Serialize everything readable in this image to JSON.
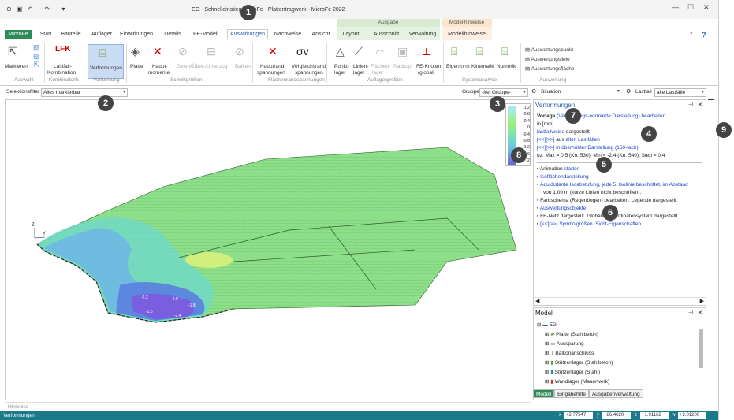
{
  "title": "EG - Schnelleinstieg MicroFe - Plattentragwerk - MicroFe 2022",
  "context_groups": {
    "ausgabe": "Ausgabe",
    "modellhinweise": "Modellhinweise"
  },
  "tabs": [
    "MicroFe",
    "Start",
    "Bauteile",
    "Auflager",
    "Einwirkungen",
    "Details",
    "FE-Modell",
    "Auswirkungen",
    "Nachweise",
    "Ansicht",
    "Layout",
    "Ausschnitt",
    "Verwaltung",
    "Modellhinweise"
  ],
  "ribbon": {
    "markieren": "Markieren",
    "lfk": "LFK",
    "lastfall": "Lastfall-",
    "kombination": "Kombination",
    "verformungen": "Verformungen",
    "platte": "Platte",
    "haupt": "Haupt-",
    "momente": "momente",
    "gelenk": "Gelenk",
    "ueber": "Über-/Unterzug",
    "balken": "Balken",
    "hauptrand": "Hauptrand-",
    "spannungen": "spannungen",
    "vergleich": "Vergleichsrand-",
    "spannungen2": "spannungen",
    "punkt": "Punkt-",
    "lager": "lager",
    "linien": "Linien-",
    "lager2": "lager",
    "flaechen": "Flächen-",
    "lager3": "lager",
    "plattkopf": "Plattkopf",
    "feknoten": "FE-Knoten",
    "global": "(global)",
    "eigenform": "Eigenform",
    "kinematik": "Kinematik",
    "numerik": "Numerik",
    "auswertungspunkt": "Auswertungspunkt",
    "auswertungslinie": "Auswertungslinie",
    "auswertungsflaeche": "Auswertungsfläche",
    "sigma": "σv",
    "groups": [
      "Auswahl",
      "Kombinatorik",
      "Verformung",
      "Schnittgrößen",
      "Flächenrandspannungen",
      "Auflagergrößen",
      "Systemanalyse",
      "Auswertung"
    ]
  },
  "filter": {
    "label": "Selektionsfilter",
    "value": "Alles markierbar",
    "gruppe_label": "Gruppe",
    "gruppe": "-frei Gruppe-",
    "situation": "Situation",
    "lastfall_label": "Lastfall",
    "lastfall": "alle Lastfälle"
  },
  "legend": [
    "1.2",
    "0.8",
    "0.4",
    "0",
    "-0.4",
    "-0.8",
    "-1.2",
    "-1.6",
    "-2"
  ],
  "panel": {
    "title": "Verformungen",
    "vorlage": "Vorlage",
    "vorlage_link": "(Verformungs-normierte Darstellung)",
    "bearbeiten": "bearbeiten",
    "unit": "in [mm]",
    "lastfallweise": "lastfallweise",
    "dargestellt": "dargestellt",
    "l1a": "[<<][>>]",
    "l1b": "aus",
    "l1c": "allen Lastfällen",
    "l2a": "[<<][>>]",
    "l2b": "in überhöhter Darstellung (150-fach)",
    "uz": "uz: Max = 0.5 (Kn. 530), Min = -2.4 (Kn. 540), Step = 0.4",
    "items": [
      [
        "Animation",
        "starten"
      ],
      [
        "Isoflächendarstellung",
        ""
      ],
      [
        "Äquidistante Isoabstufung, jede 5. Isolinie beschriftet, im Abstand",
        "von 1.00 m (kurze Linien nicht beschriften)."
      ],
      [
        "Farbschema (Regenbogen) bearbeiten.",
        "Legende dargestellt."
      ],
      [
        "Auswertungsobjekte",
        ""
      ],
      [
        "FE-Netz dargestellt. Globales Koordinatensystem dargestellt.",
        ""
      ],
      [
        "[<<][>>] Symbolgrößen. Sicht-Eigenschaften",
        ""
      ]
    ]
  },
  "model": {
    "title": "Modell",
    "root": "EG",
    "items": [
      "Platte (Stahlbeton)",
      "Aussparung",
      "Balkonanschluss",
      "Stützenlager (Stahlbeton)",
      "Stützenlager (Stahl)",
      "Wandlager (Mauerwerk)"
    ]
  },
  "bottom_tabs": [
    "Modell",
    "Eingabehilfe",
    "Ausgabenverwaltung"
  ],
  "hinweise": "Hinweise",
  "status": {
    "mode": "Verformungen",
    "x": "+2.77547",
    "y": "+86.4620",
    "z": "+1.91182",
    "w": "+2.01200",
    "xl": "x",
    "yl": "y",
    "zl": "z",
    "wl": "w"
  },
  "callouts": [
    "1",
    "2",
    "3",
    "4",
    "5",
    "6",
    "7",
    "8",
    "9"
  ],
  "axis": {
    "z": "Z",
    "y": "Y"
  },
  "contour_labels": [
    "-2.2",
    "-2.0",
    "-1.8",
    "-1.5",
    "-2.4"
  ]
}
